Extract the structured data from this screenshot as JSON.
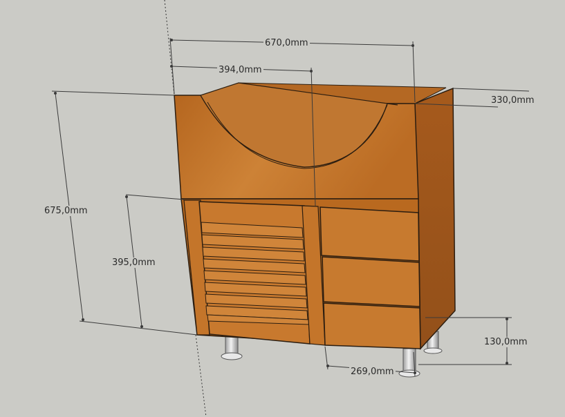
{
  "dimensions": {
    "total_width": "670,0mm",
    "door_width": "394,0mm",
    "depth": "330,0mm",
    "total_height": "675,0mm",
    "door_height": "395,0mm",
    "leg_height": "130,0mm",
    "drawer_width": "269,0mm"
  },
  "colors": {
    "background": "#cbcbc6",
    "wood_front": "#c2742a",
    "wood_side": "#a85d1e",
    "wood_inside": "#b86a26",
    "edge": "#2b1d10",
    "dimension_line": "#3a3a3a",
    "leg_metal": "#d9d9d9"
  }
}
